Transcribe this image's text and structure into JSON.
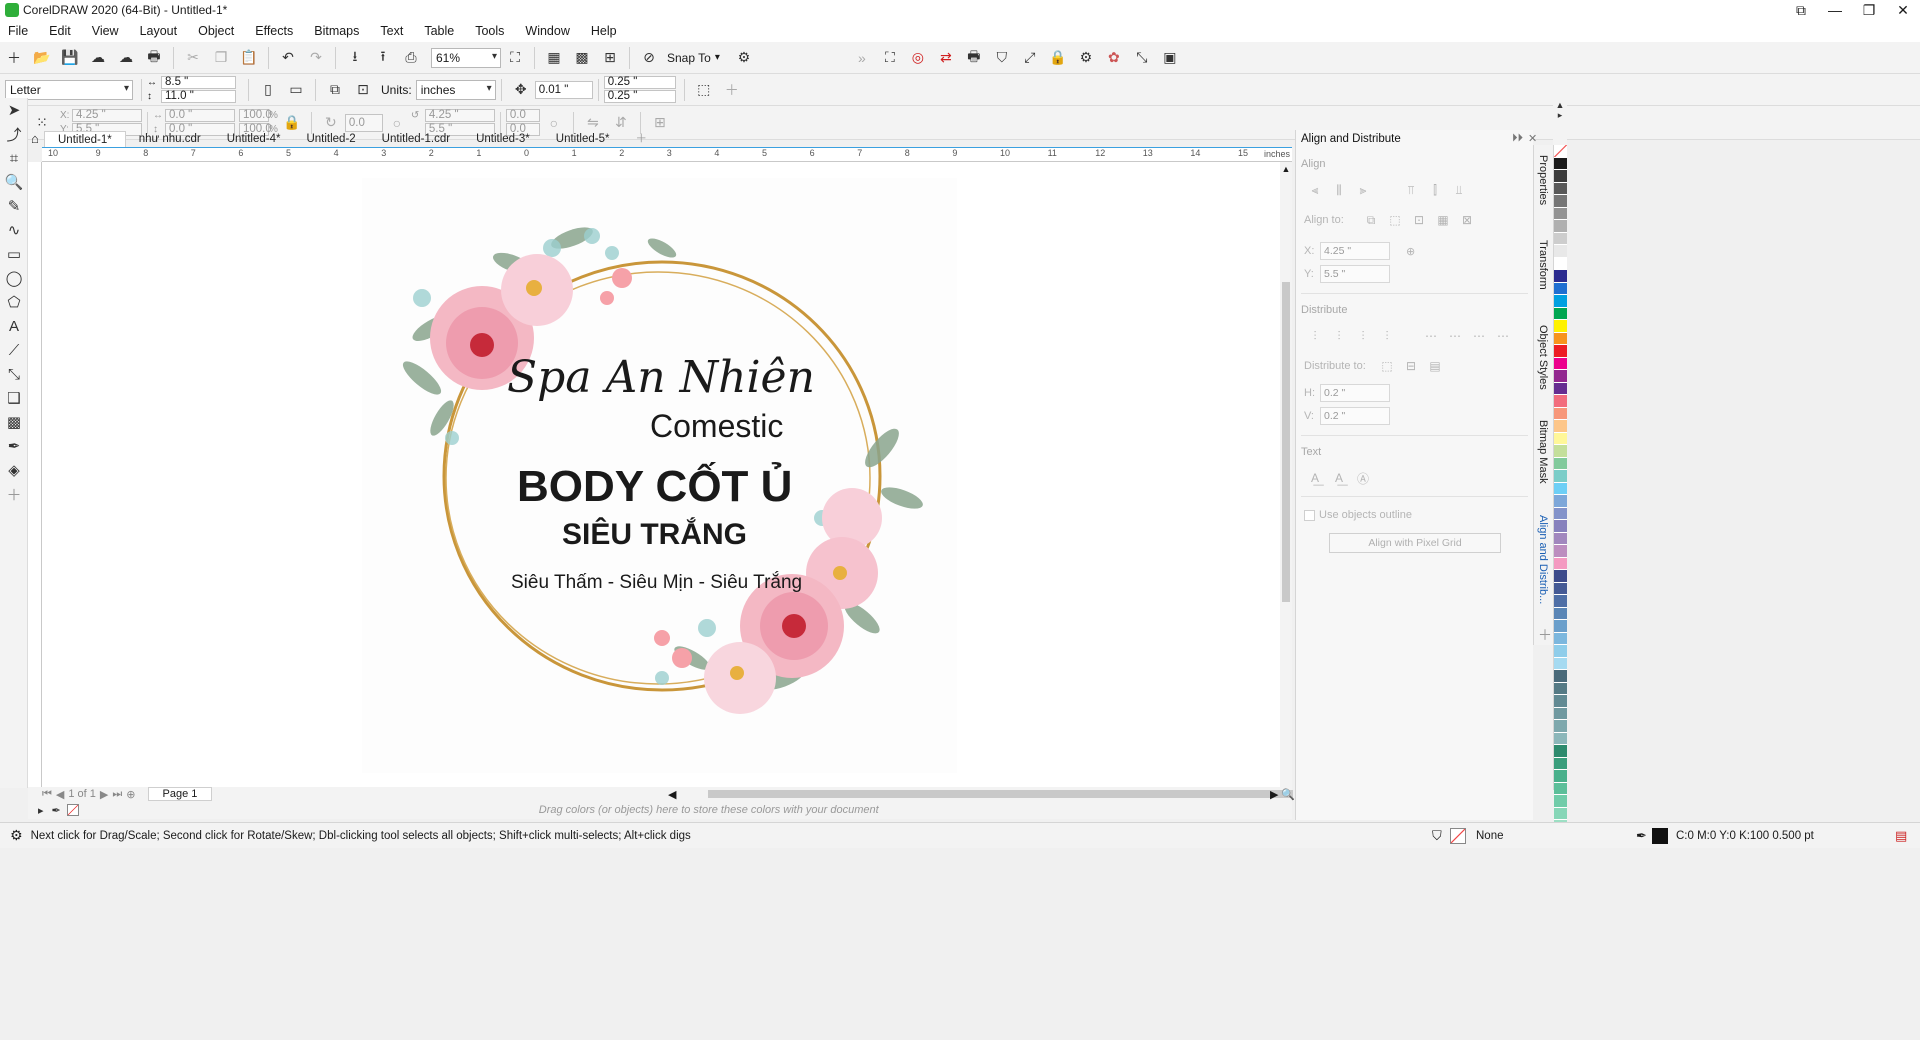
{
  "window": {
    "title": "CorelDRAW 2020 (64-Bit) - Untitled-1*",
    "controls": [
      "⧉",
      "—",
      "❐",
      "✕"
    ]
  },
  "menu": [
    "File",
    "Edit",
    "View",
    "Layout",
    "Object",
    "Effects",
    "Bitmaps",
    "Text",
    "Table",
    "Tools",
    "Window",
    "Help"
  ],
  "standard_toolbar": {
    "zoom": "61%",
    "snap_to": "Snap To"
  },
  "property_bar": {
    "page_size": "Letter",
    "width": "8.5 \"",
    "height": "11.0 \"",
    "units_label": "Units:",
    "units": "inches",
    "nudge": "0.01 \"",
    "dup_x": "0.25 \"",
    "dup_y": "0.25 \""
  },
  "transform_bar": {
    "x": "4.25 \"",
    "y": "5.5 \"",
    "w": "0.0 \"",
    "h": "0.0 \"",
    "scale_x": "100.0",
    "scale_y": "100.0",
    "pct": "%",
    "angle": "0.0",
    "cx": "4.25 \"",
    "cy": "5.5 \"",
    "skew_x": "0.0",
    "skew_y": "0.0"
  },
  "tabs": [
    "Untitled-1*",
    "như nhu.cdr",
    "Untitled-4*",
    "Untitled-2",
    "Untitled-1.cdr",
    "Untitled-3*",
    "Untitled-5*"
  ],
  "active_tab": 0,
  "ruler": {
    "labels": [
      "10",
      "9",
      "8",
      "7",
      "6",
      "5",
      "4",
      "3",
      "2",
      "1",
      "0",
      "1",
      "2",
      "3",
      "4",
      "5",
      "6",
      "7",
      "8",
      "9",
      "10",
      "11",
      "12",
      "13",
      "14",
      "15"
    ],
    "units": "inches"
  },
  "artwork": {
    "line1": "Spa An Nhiên",
    "line2": "Comestic",
    "line3": "BODY CỐT Ủ",
    "line4": "SIÊU TRẮNG",
    "line5": "Siêu Thấm - Siêu Mịn - Siêu Trắng"
  },
  "page_nav": {
    "of_text": "1 of 1",
    "page_tab": "Page 1"
  },
  "colorwell_hint": "Drag colors (or objects) here to store these colors with your document",
  "status": {
    "hint": "Next click for Drag/Scale; Second click for Rotate/Skew; Dbl-clicking tool selects all objects; Shift+click multi-selects; Alt+click digs",
    "fill": "None",
    "outline": "C:0 M:0 Y:0 K:100  0.500 pt"
  },
  "docker": {
    "title": "Align and Distribute",
    "align": "Align",
    "align_to": "Align to:",
    "x_label": "X:",
    "x": "4.25 \"",
    "y_label": "Y:",
    "y": "5.5 \"",
    "distribute": "Distribute",
    "distribute_to": "Distribute to:",
    "h_label": "H:",
    "h": "0.2 \"",
    "v_label": "V:",
    "v": "0.2 \"",
    "text": "Text",
    "use_outline": "Use objects outline",
    "pixel_grid": "Align with Pixel Grid"
  },
  "side_tabs": [
    "Properties",
    "Transform",
    "Object Styles",
    "Bitmap Mask",
    "Align and Distrib..."
  ],
  "palette": [
    "#ffffff",
    "#1a1a1a",
    "#3b3b3b",
    "#595959",
    "#767676",
    "#939393",
    "#b0b0b0",
    "#cdcdcd",
    "#e8e8e8",
    "#ffffff",
    "#2b2b8f",
    "#1f6fd1",
    "#00a0e0",
    "#00a651",
    "#fff200",
    "#f7941d",
    "#ed1c24",
    "#ec008c",
    "#92278f",
    "#662d91",
    "#f26d7d",
    "#f7977a",
    "#fdc689",
    "#fff799",
    "#c4df9b",
    "#82ca9c",
    "#7bcdc8",
    "#6dcff6",
    "#7da7d9",
    "#8393ca",
    "#8781bd",
    "#a187be",
    "#bc8dbf",
    "#f49ac1",
    "#3d4b8b",
    "#455a95",
    "#4f6fa6",
    "#5a86b6",
    "#6b9fcb",
    "#7cb7de",
    "#8fcdea",
    "#a5daf1",
    "#4a6a7a",
    "#557a85",
    "#628a93",
    "#7099a0",
    "#7ea8ad",
    "#8cb7ba",
    "#2e8b6e",
    "#3a9e7c",
    "#49b08b",
    "#5cbf9a",
    "#70cca9",
    "#86d6b7",
    "#9ddfc4",
    "#b5e8d2"
  ]
}
